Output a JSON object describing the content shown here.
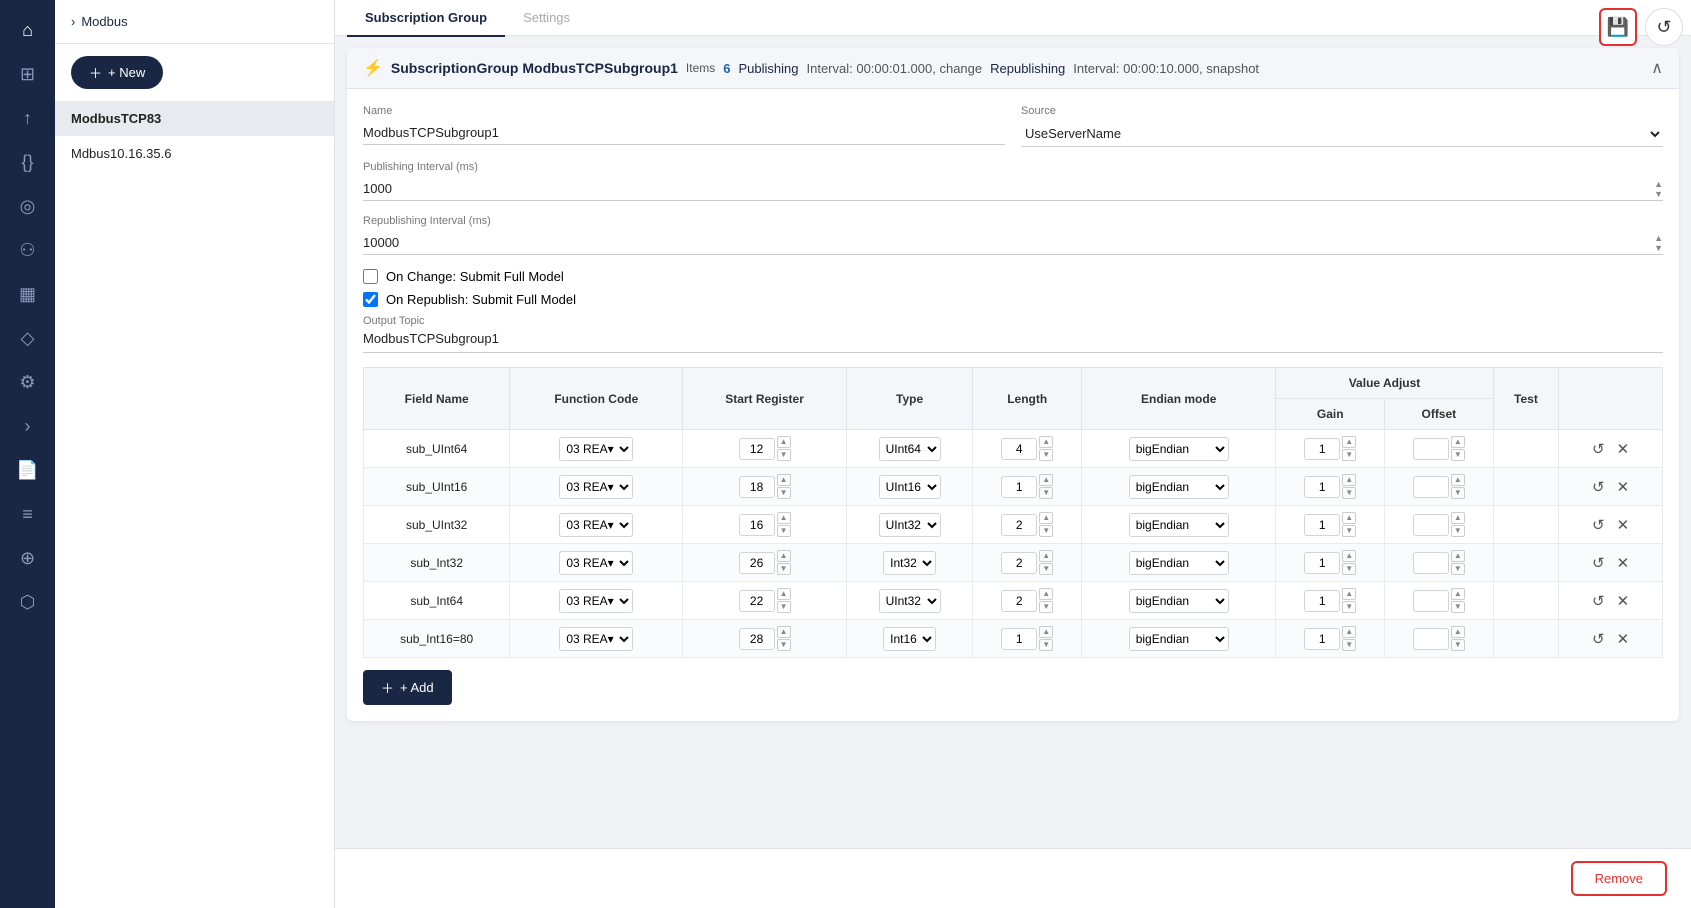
{
  "sidebar_icons": [
    {
      "name": "home-icon",
      "icon": "⌂"
    },
    {
      "name": "dashboard-icon",
      "icon": "⊞"
    },
    {
      "name": "share-icon",
      "icon": "↑"
    },
    {
      "name": "code-icon",
      "icon": "{}"
    },
    {
      "name": "wifi-icon",
      "icon": "◎"
    },
    {
      "name": "user-group-icon",
      "icon": "⚇"
    },
    {
      "name": "table-icon",
      "icon": "▦"
    },
    {
      "name": "diamond-icon",
      "icon": "◇"
    },
    {
      "name": "workflow-icon",
      "icon": "⚙"
    },
    {
      "name": "arrow-right-icon",
      "icon": ">"
    },
    {
      "name": "file-icon",
      "icon": "📄"
    },
    {
      "name": "stream-icon",
      "icon": "≡"
    },
    {
      "name": "map-icon",
      "icon": "⊕"
    },
    {
      "name": "box-icon",
      "icon": "⬡"
    }
  ],
  "breadcrumb": "Modbus",
  "new_button_label": "+ New",
  "nav_items": [
    {
      "label": "ModbusTCP83",
      "active": true
    },
    {
      "label": "Mdbus10.16.35.6",
      "active": false
    }
  ],
  "tabs": [
    {
      "label": "Subscription Group",
      "active": true
    },
    {
      "label": "Settings",
      "active": false
    }
  ],
  "group": {
    "icon": "⚡",
    "name": "SubscriptionGroup ModbusTCPSubgroup1",
    "items_label": "Items",
    "items_count": "6",
    "publishing_label": "Publishing",
    "publishing_value": "Interval: 00:00:01.000, change",
    "republishing_label": "Republishing",
    "republishing_value": "Interval: 00:00:10.000, snapshot"
  },
  "form": {
    "name_label": "Name",
    "name_value": "ModbusTCPSubgroup1",
    "source_label": "Source",
    "source_value": "UseServerName",
    "publishing_interval_label": "Publishing Interval (ms)",
    "publishing_interval_value": "1000",
    "republishing_interval_label": "Republishing Interval (ms)",
    "republishing_interval_value": "10000",
    "on_change_label": "On Change: Submit Full Model",
    "on_republish_label": "On Republish: Submit Full Model",
    "output_topic_label": "Output Topic",
    "output_topic_value": "ModbusTCPSubgroup1"
  },
  "table": {
    "headers": {
      "field_name": "Field Name",
      "function_code": "Function Code",
      "start_register": "Start Register",
      "type": "Type",
      "length": "Length",
      "endian_mode": "Endian mode",
      "value_adjust": "Value Adjust",
      "gain": "Gain",
      "offset": "Offset",
      "test": "Test"
    },
    "rows": [
      {
        "field_name": "sub_UInt64",
        "function_code": "03 REA",
        "start_register": "12",
        "type": "UInt64",
        "length": "4",
        "endian_mode": "bigEndian",
        "gain": "1",
        "offset": ""
      },
      {
        "field_name": "sub_UInt16",
        "function_code": "03 REA",
        "start_register": "18",
        "type": "UInt16",
        "length": "1",
        "endian_mode": "bigEndian",
        "gain": "1",
        "offset": ""
      },
      {
        "field_name": "sub_UInt32",
        "function_code": "03 REA",
        "start_register": "16",
        "type": "UInt32",
        "length": "2",
        "endian_mode": "bigEndian",
        "gain": "1",
        "offset": ""
      },
      {
        "field_name": "sub_Int32",
        "function_code": "03 REA",
        "start_register": "26",
        "type": "Int32",
        "length": "2",
        "endian_mode": "bigEndian",
        "gain": "1",
        "offset": ""
      },
      {
        "field_name": "sub_Int64",
        "function_code": "03 REA",
        "start_register": "22",
        "type": "UInt32",
        "length": "2",
        "endian_mode": "bigEndian",
        "gain": "1",
        "offset": ""
      },
      {
        "field_name": "sub_Int16=80",
        "function_code": "03 REA",
        "start_register": "28",
        "type": "Int16",
        "length": "1",
        "endian_mode": "bigEndian",
        "gain": "1",
        "offset": ""
      }
    ]
  },
  "add_button_label": "+ Add",
  "remove_button_label": "Remove",
  "save_button_title": "Save",
  "refresh_button_title": "Refresh"
}
